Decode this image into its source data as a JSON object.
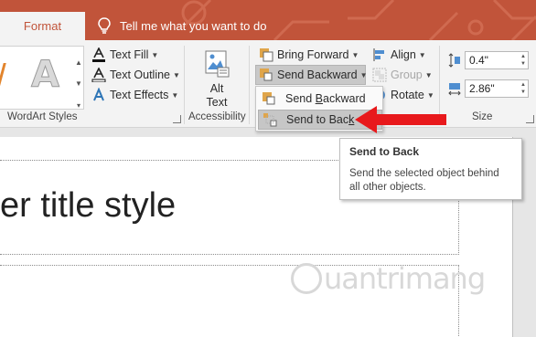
{
  "tabbar": {
    "active_tab": "Format",
    "tell_me": "Tell me what you want to do"
  },
  "ribbon": {
    "wordart": {
      "text_fill": "Text Fill",
      "text_outline": "Text Outline",
      "text_effects": "Text Effects",
      "group_label": "WordArt Styles"
    },
    "accessibility": {
      "alt_text_line1": "Alt",
      "alt_text_line2": "Text",
      "group_label": "Accessibility"
    },
    "arrange": {
      "bring_forward": "Bring Forward",
      "send_backward": "Send Backward",
      "align": "Align",
      "group": "Group",
      "rotate": "Rotate"
    },
    "size": {
      "height": "0.4\"",
      "width": "2.86\"",
      "group_label": "Size"
    }
  },
  "dropdown": {
    "items": [
      {
        "label": "Send Backward",
        "accel": "B"
      },
      {
        "label": "Send to Back",
        "accel": "k"
      }
    ]
  },
  "tooltip": {
    "title": "Send to Back",
    "body": "Send the selected object behind all other objects."
  },
  "slide": {
    "title_text": "er title style"
  },
  "watermark": {
    "text": "uantrimang"
  },
  "colors": {
    "accent": "#c1543a",
    "arrow": "#e8191c",
    "hover": "#c6c6c6"
  }
}
